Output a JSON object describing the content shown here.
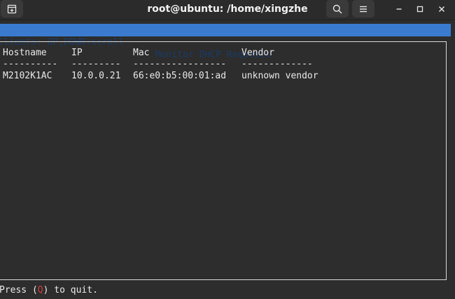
{
  "window": {
    "title": "root@ubuntu: /home/xingzhe",
    "icons": [
      "new-tab-icon",
      "search-icon",
      "hamburger-menu-icon",
      "minimize-icon",
      "maximize-icon",
      "close-icon"
    ]
  },
  "header": {
    "left_text": "Clients: UP,DOWN:scroll",
    "right_text": "Monitor DHCP Requests",
    "color": "#3a7bd0"
  },
  "table": {
    "columns": [
      "Hostname",
      "IP",
      "Mac",
      "Vendor"
    ],
    "separators": [
      "----------",
      "---------",
      "-----------------",
      "-------------"
    ],
    "rows": [
      {
        "hostname": "M2102K1AC",
        "ip": "10.0.0.21",
        "mac": "66:e0:b5:00:01:ad",
        "vendor": "unknown vendor"
      }
    ]
  },
  "footer": {
    "prefix": "Press (",
    "key": "Q",
    "suffix": ") to quit.",
    "key_color": "#d23b3b"
  }
}
